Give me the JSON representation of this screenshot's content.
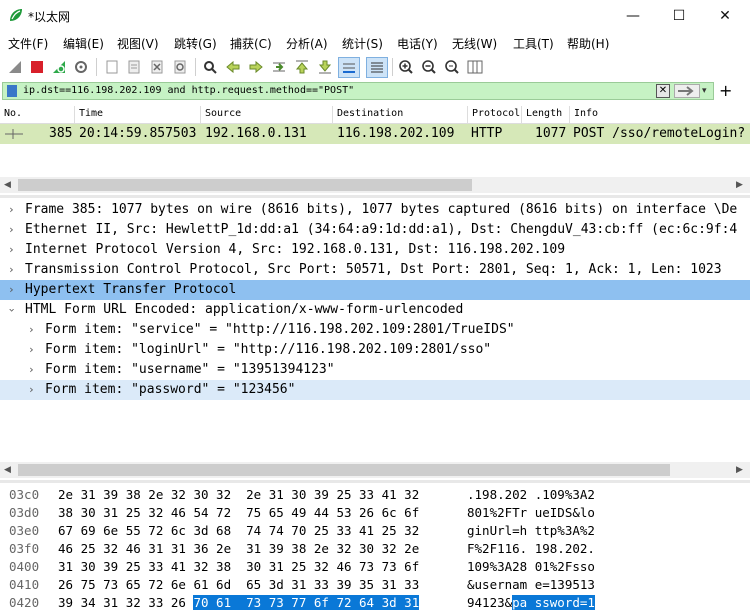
{
  "window": {
    "title": "*以太网",
    "min_glyph": "—",
    "max_glyph": "☐",
    "close_glyph": "✕"
  },
  "menu": [
    "文件(F)",
    "编辑(E)",
    "视图(V)",
    "跳转(G)",
    "捕获(C)",
    "分析(A)",
    "统计(S)",
    "电话(Y)",
    "无线(W)",
    "工具(T)",
    "帮助(H)"
  ],
  "filter": {
    "text": "ip.dst==116.198.202.109  and  http.request.method==\"POST\""
  },
  "packet_list": {
    "headers": [
      "No.",
      "Time",
      "Source",
      "Destination",
      "Protocol",
      "Length",
      "Info"
    ],
    "row": {
      "no": "385",
      "time": "20:14:59.857503",
      "src": "192.168.0.131",
      "dst": "116.198.202.109",
      "proto": "HTTP",
      "len": "1077",
      "info": "POST /sso/remoteLogin?"
    }
  },
  "details": [
    "Frame 385: 1077 bytes on wire (8616 bits), 1077 bytes captured (8616 bits) on interface \\De",
    "Ethernet II, Src: HewlettP_1d:dd:a1 (34:64:a9:1d:dd:a1), Dst: ChengduV_43:cb:ff (ec:6c:9f:4",
    "Internet Protocol Version 4, Src: 192.168.0.131, Dst: 116.198.202.109",
    "Transmission Control Protocol, Src Port: 50571, Dst Port: 2801, Seq: 1, Ack: 1, Len: 1023",
    "Hypertext Transfer Protocol",
    "HTML Form URL Encoded: application/x-www-form-urlencoded",
    "Form item: \"service\" = \"http://116.198.202.109:2801/TrueIDS\"",
    "Form item: \"loginUrl\" = \"http://116.198.202.109:2801/sso\"",
    "Form item: \"username\" = \"13951394123\"",
    "Form item: \"password\" = \"123456\""
  ],
  "bytes": [
    {
      "off": "03c0",
      "hex": "2e 31 39 38 2e 32 30 32  2e 31 30 39 25 33 41 32",
      "ascii": ".198.202 .109%3A2"
    },
    {
      "off": "03d0",
      "hex": "38 30 31 25 32 46 54 72  75 65 49 44 53 26 6c 6f",
      "ascii": "801%2FTr ueIDS&lo"
    },
    {
      "off": "03e0",
      "hex": "67 69 6e 55 72 6c 3d 68  74 74 70 25 33 41 25 32",
      "ascii": "ginUrl=h ttp%3A%2"
    },
    {
      "off": "03f0",
      "hex": "46 25 32 46 31 31 36 2e  31 39 38 2e 32 30 32 2e",
      "ascii": "F%2F116. 198.202."
    },
    {
      "off": "0400",
      "hex": "31 30 39 25 33 41 32 38  30 31 25 32 46 73 73 6f",
      "ascii": "109%3A28 01%2Fsso"
    },
    {
      "off": "0410",
      "hex": "26 75 73 65 72 6e 61 6d  65 3d 31 33 39 35 31 33",
      "ascii": "&usernam e=139513"
    },
    {
      "off": "0420",
      "hex_a": "39 34 31 32 33 26 ",
      "hex_b": "70 61  73 73 77 6f 72 64 3d 31",
      "ascii_a": "94123&",
      "ascii_b": "pa ssword=1"
    }
  ],
  "colors": {
    "filter_bg": "#c6f2c4",
    "row_bg": "#d6e8b8",
    "select_bg": "#8ec0f0",
    "hover_bg": "#dbeaf9",
    "hl": "#0a78d7"
  }
}
